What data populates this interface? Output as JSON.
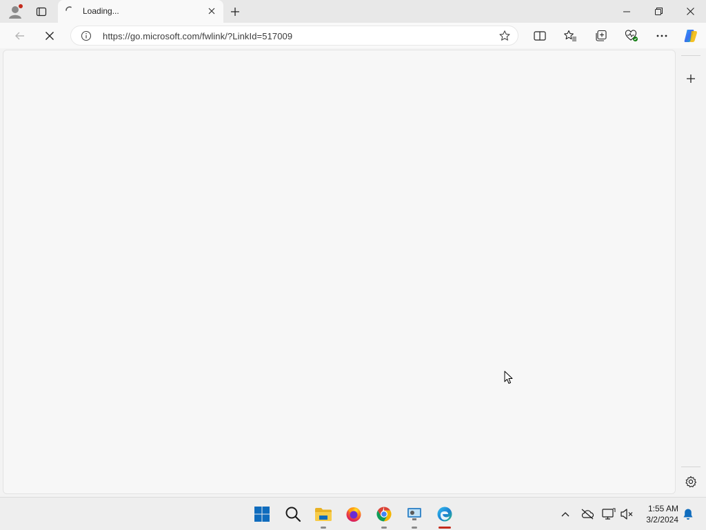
{
  "browser": {
    "tab": {
      "title": "Loading..."
    },
    "address_bar": {
      "url": "https://go.microsoft.com/fwlink/?LinkId=517009"
    }
  },
  "icons": {
    "profile": "profile-icon",
    "workspaces": "tab-actions-icon",
    "new_tab": "plus-icon",
    "back": "back-arrow-icon",
    "stop": "stop-x-icon",
    "info": "info-icon",
    "favorite": "star-icon",
    "split": "split-screen-icon",
    "favorites": "favorites-icon",
    "collections": "collections-icon",
    "performance": "heart-pulse-icon",
    "more": "more-icon",
    "copilot": "copilot-icon",
    "sidebar_add": "plus-icon",
    "sidebar_settings": "gear-icon"
  },
  "taskbar": {
    "apps": [
      "start",
      "search",
      "file-explorer",
      "firefox",
      "chrome",
      "network-tool",
      "edge"
    ],
    "clock": {
      "time": "1:55 AM",
      "date": "3/2/2024"
    }
  },
  "colors": {
    "accent": "#0067c0",
    "notification_dot": "#c42b1c",
    "page_bg": "#f7f7f7"
  }
}
